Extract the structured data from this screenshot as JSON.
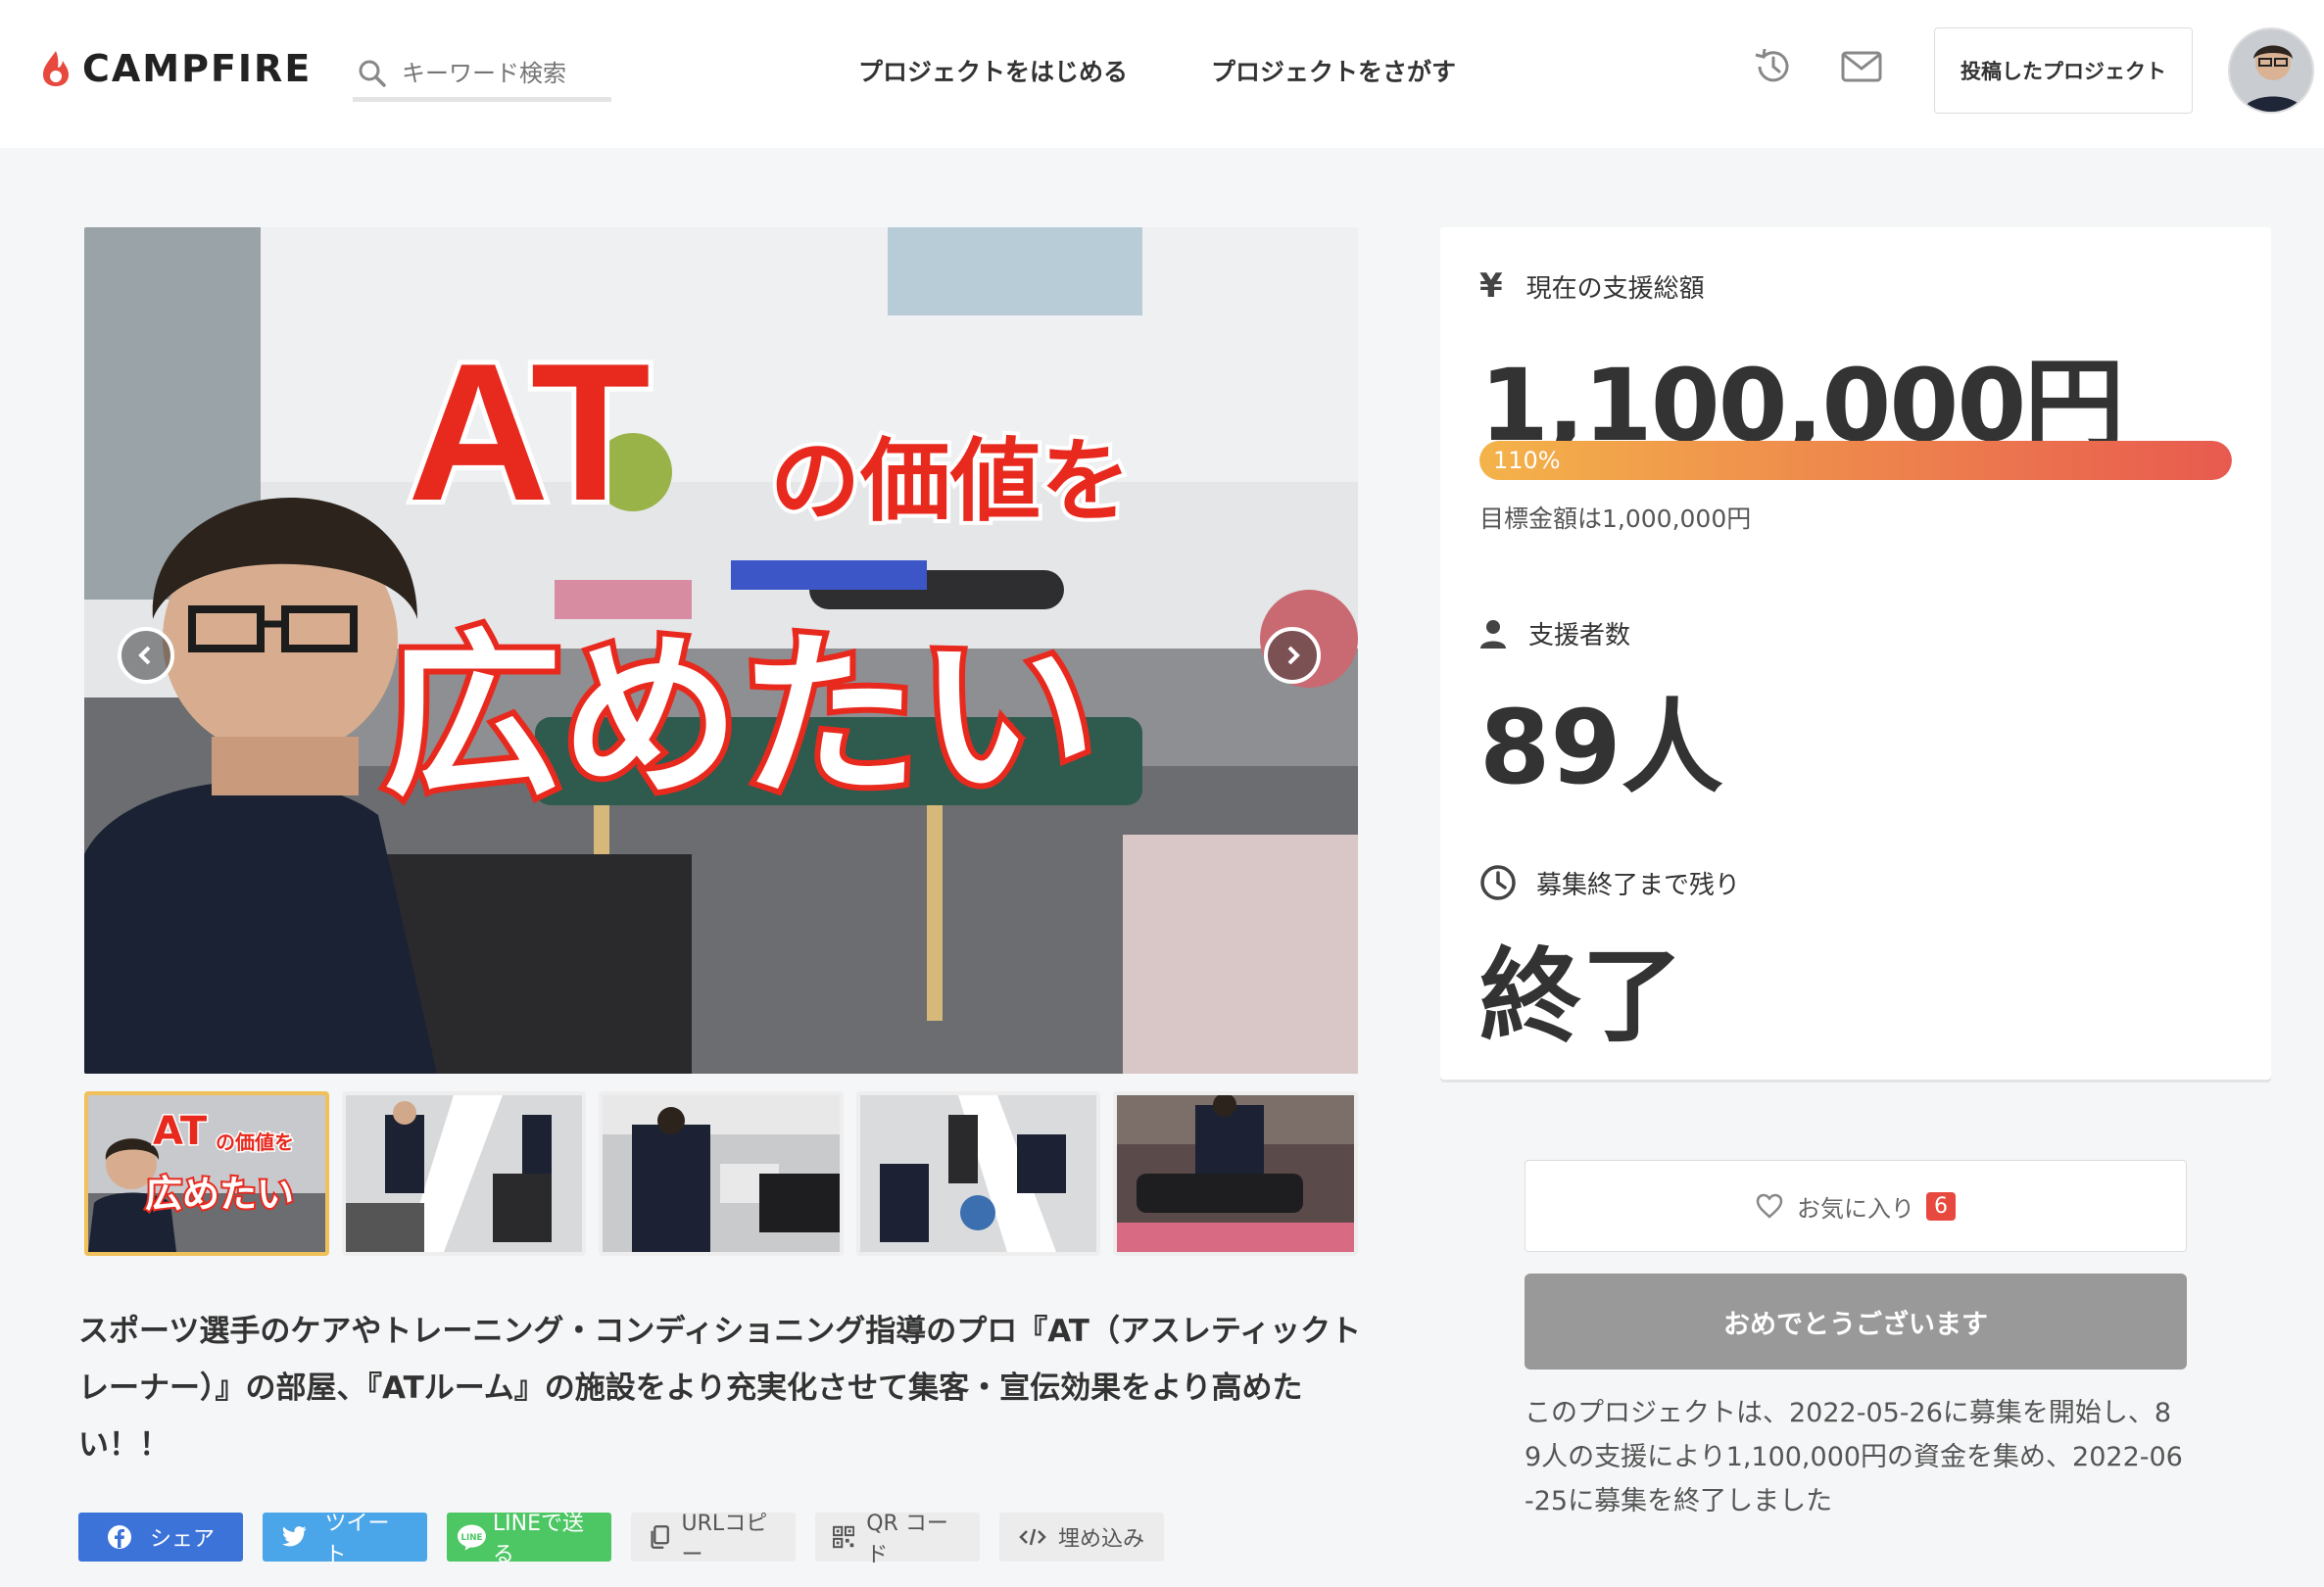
{
  "header": {
    "logo_text": "CAMPFIRE",
    "search_placeholder": "キーワード検索",
    "nav": {
      "start": "プロジェクトをはじめる",
      "search": "プロジェクトをさがす"
    },
    "posted_projects": "投稿したプロジェクト"
  },
  "hero": {
    "title_line1": "AT",
    "title_line1_suffix": "の価値を",
    "title_line2": "広めたい"
  },
  "thumbnails": [
    {
      "caption_a": "AT",
      "caption_a_suffix": "の価値を",
      "caption_b": "広めたい"
    },
    {
      "caption_a": ""
    },
    {
      "caption_a": ""
    },
    {
      "caption_a": ""
    },
    {
      "caption_a": ""
    }
  ],
  "description": "スポーツ選手のケアやトレーニング・コンディショニング指導のプロ『AT（アスレティックトレーナー）』の部屋、『ATルーム』の施設をより充実化させて集客・宣伝効果をより高めたい！！",
  "share": {
    "facebook": "シェア",
    "twitter": "ツイート",
    "line": "LINEで送る",
    "url": "URLコピー",
    "qr": "QR コード",
    "embed": "埋め込み"
  },
  "stats": {
    "total_label": "現在の支援総額",
    "total_value": "1,100,000円",
    "progress_text": "110%",
    "progress_fraction": 1.0,
    "goal_text": "目標金額は1,000,000円",
    "backers_label": "支援者数",
    "backers_value": "89人",
    "remaining_label": "募集終了まで残り",
    "remaining_value": "終了"
  },
  "actions": {
    "favorite_label": "お気に入り",
    "favorite_count": "6",
    "congrats_label": "おめでとうございます",
    "summary": "このプロジェクトは、2022-05-26に募集を開始し、89人の支援により1,100,000円の資金を集め、2022-06-25に募集を終了しました"
  },
  "colors": {
    "accent": "#e8493f",
    "facebook": "#3b73d9",
    "twitter": "#4aa6e9",
    "line": "#4cc764"
  }
}
